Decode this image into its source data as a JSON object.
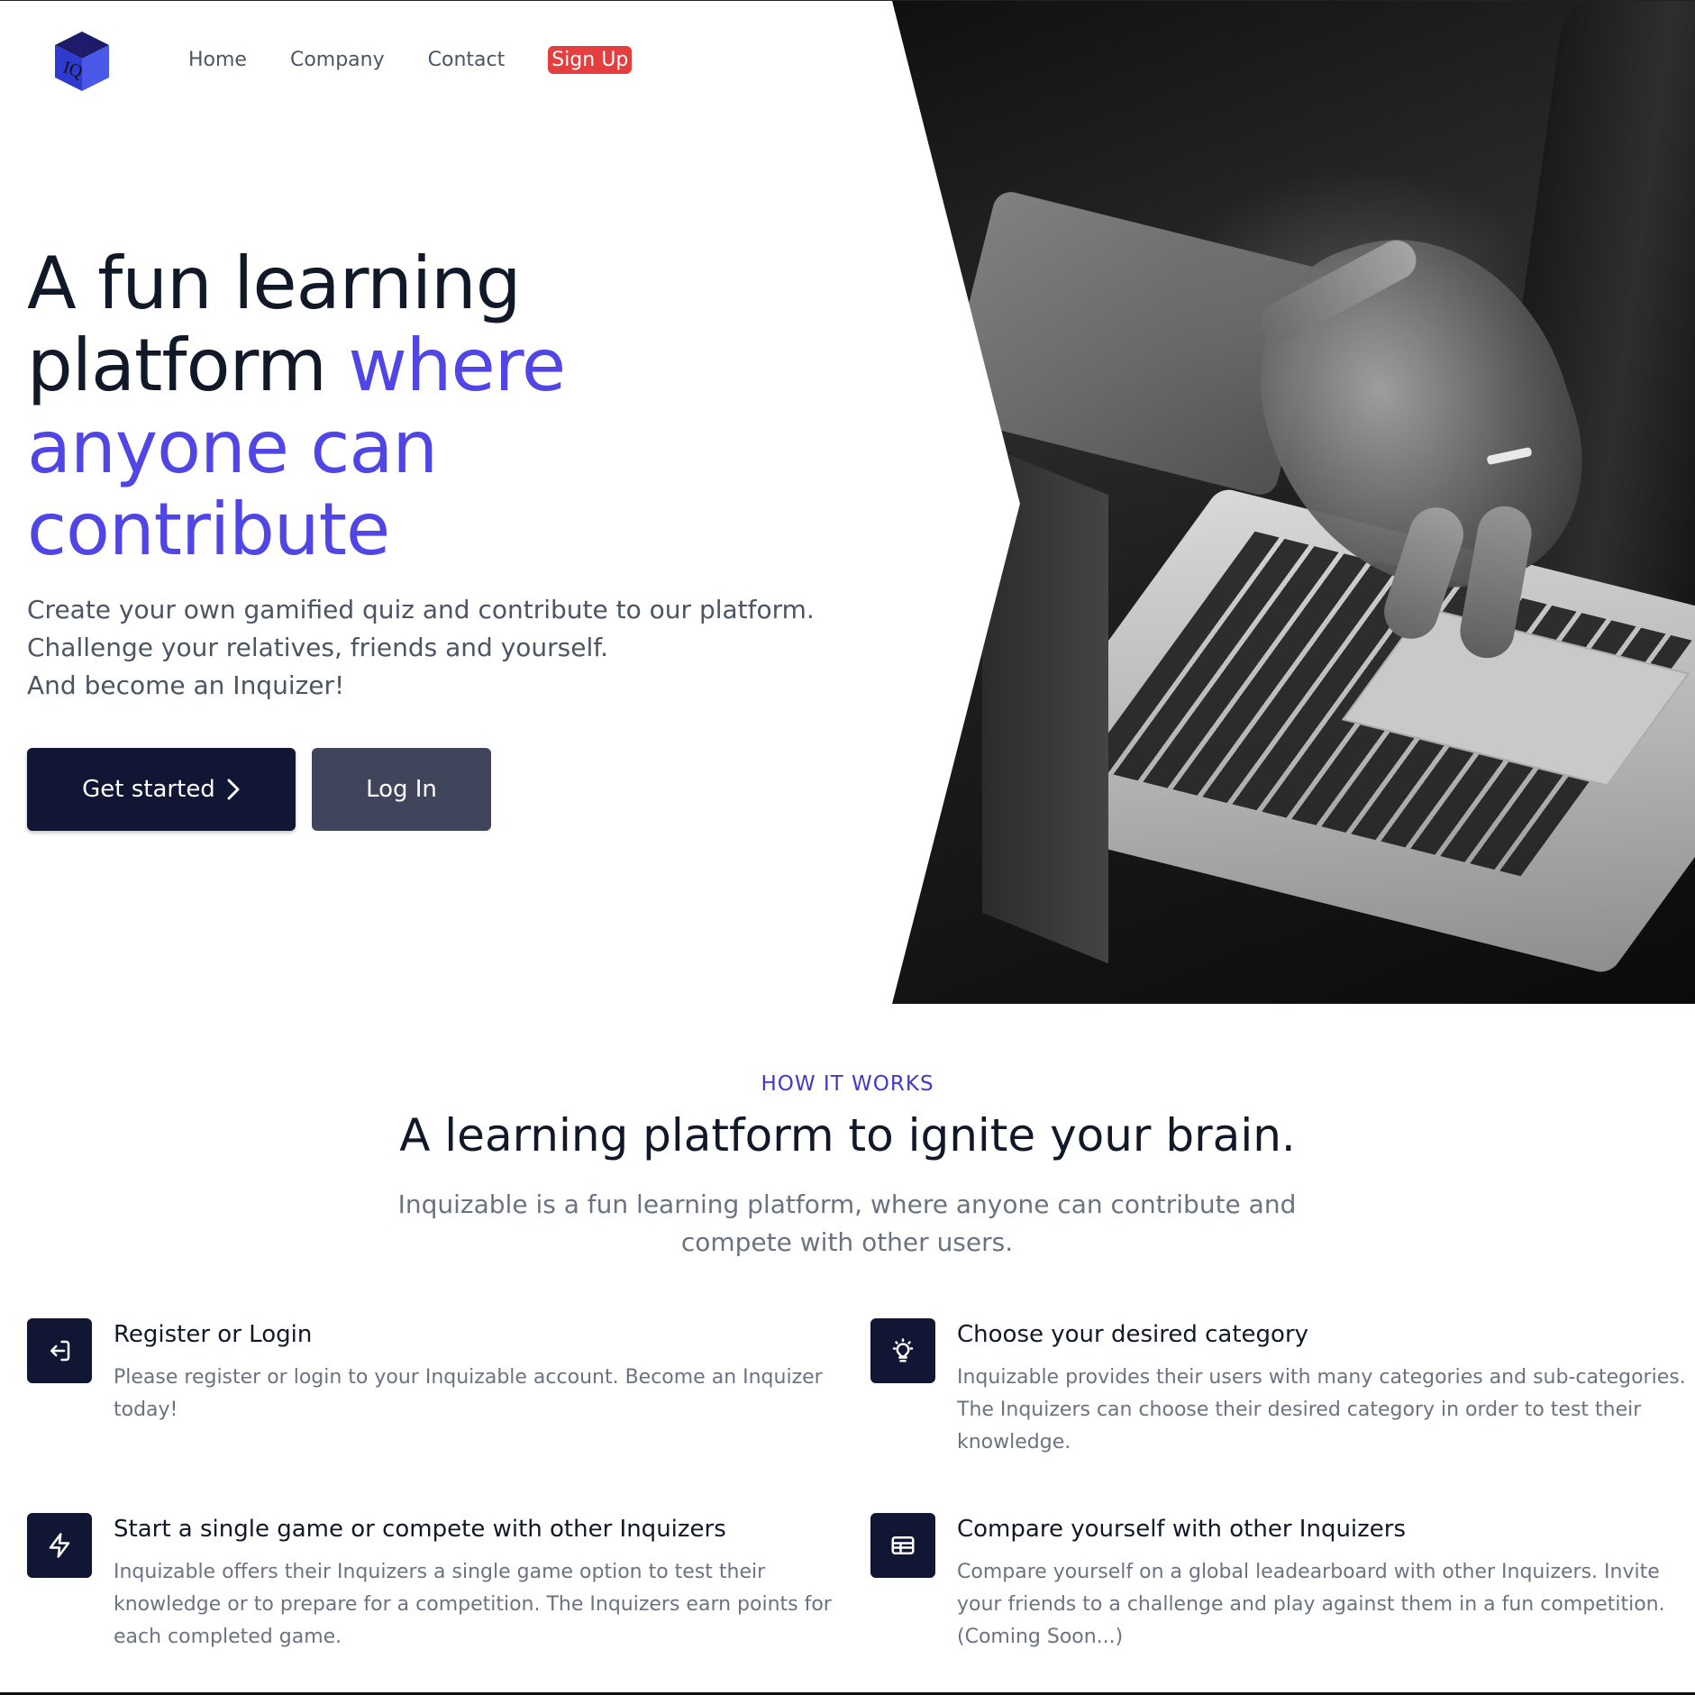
{
  "nav": {
    "logo_text": "IQ",
    "items": [
      "Home",
      "Company",
      "Contact"
    ],
    "signup_label": "Sign Up"
  },
  "hero": {
    "title_dark": "A fun learning platform ",
    "title_accent": "where anyone can contribute",
    "subtitle_lines": [
      "Create your own gamified quiz and contribute to our platform.",
      "Challenge your relatives, friends and yourself.",
      "And become an Inquizer!"
    ],
    "primary_button": "Get started",
    "secondary_button": "Log In"
  },
  "how_it_works": {
    "eyebrow": "HOW IT WORKS",
    "title": "A learning platform to ignite your brain.",
    "subtitle": "Inquizable is a fun learning platform, where anyone can contribute and compete with other users.",
    "features": [
      {
        "icon": "login-icon",
        "title": "Register or Login",
        "text": "Please register or login to your Inquizable account. Become an Inquizer today!"
      },
      {
        "icon": "lightbulb-icon",
        "title": "Choose your desired category",
        "text": "Inquizable provides their users with many categories and sub-categories. The Inquizers can choose their desired category in order to test their knowledge."
      },
      {
        "icon": "lightning-bolt-icon",
        "title": "Start a single game or compete with other Inquizers",
        "text": "Inquizable offers their Inquizers a single game option to test their knowledge or to prepare for a competition. The Inquizers earn points for each completed game."
      },
      {
        "icon": "leaderboard-table-icon",
        "title": "Compare yourself with other Inquizers",
        "text": "Compare yourself on a global leadearboard with other Inquizers. Invite your friends to a challenge and play against them in a fun competition. (Coming Soon...)"
      }
    ]
  },
  "colors": {
    "accent": "#4f46e5",
    "signup": "#e53e3e",
    "dark_button": "#111634",
    "secondary_button": "#41455b"
  }
}
